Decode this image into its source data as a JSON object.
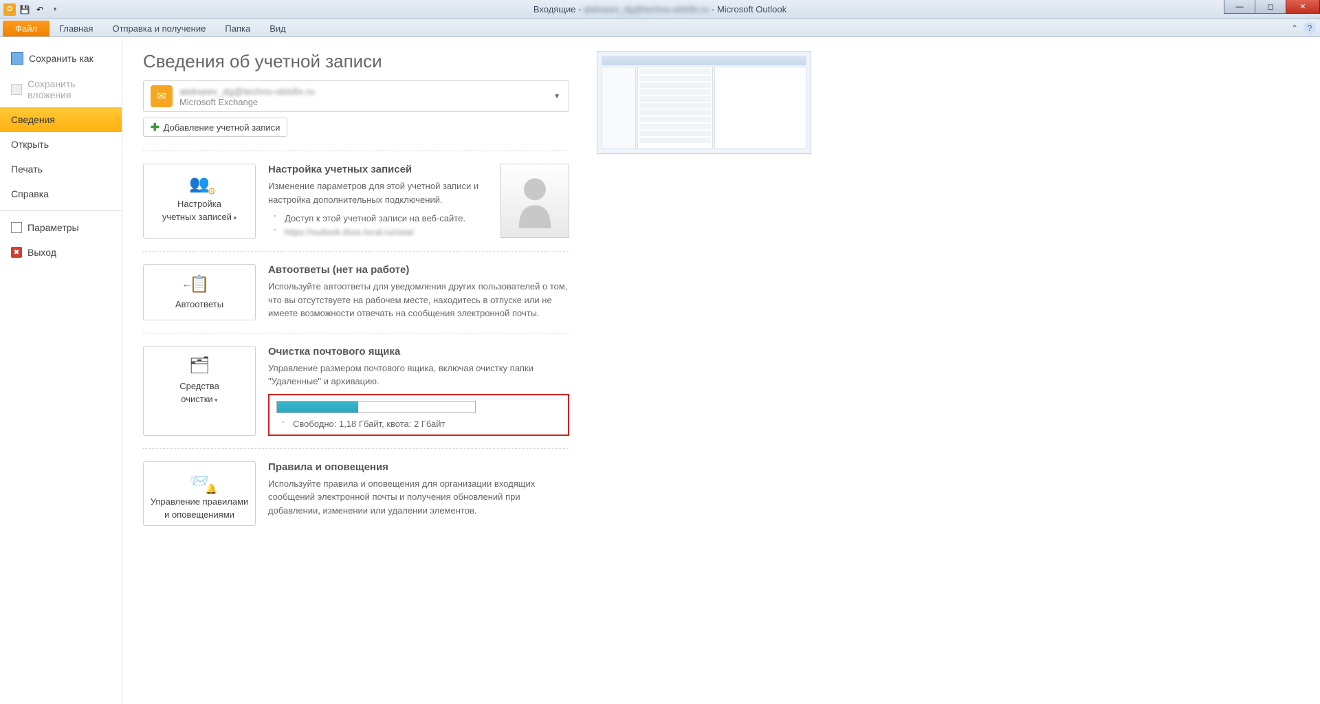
{
  "titlebar": {
    "inbox": "Входящие -",
    "email_blur": "alekseev_dg@techno-oblsfin.ru",
    "app": "- Microsoft Outlook"
  },
  "ribbon": {
    "file": "Файл",
    "home": "Главная",
    "sendreceive": "Отправка и получение",
    "folder": "Папка",
    "view": "Вид"
  },
  "nav": {
    "save_as": "Сохранить как",
    "save_attach": "Сохранить вложения",
    "info": "Сведения",
    "open": "Открыть",
    "print": "Печать",
    "help": "Справка",
    "options": "Параметры",
    "exit": "Выход"
  },
  "page": {
    "title": "Сведения об учетной записи",
    "account_blur": "alekseev_dg@techno-oblsfin.ru",
    "account_type": "Microsoft Exchange",
    "add_account": "Добавление учетной записи"
  },
  "sec_settings": {
    "btn_line1": "Настройка",
    "btn_line2": "учетных записей",
    "title": "Настройка учетных записей",
    "desc": "Изменение параметров для этой учетной записи и настройка дополнительных подключений.",
    "bullet1": "Доступ к этой учетной записи на веб-сайте.",
    "bullet2_blur": "https://outlook.dsss.local.ru/owa/"
  },
  "sec_auto": {
    "btn": "Автоответы",
    "title": "Автоответы (нет на работе)",
    "desc": "Используйте автоответы для уведомления других пользователей о том, что вы отсутствуете на рабочем месте, находитесь в отпуске или не имеете возможности отвечать на сообщения электронной почты."
  },
  "sec_clean": {
    "btn_line1": "Средства",
    "btn_line2": "очистки",
    "title": "Очистка почтового ящика",
    "desc": "Управление размером почтового ящика, включая очистку папки \"Удаленные\" и архивацию.",
    "quota_text": "Свободно: 1,18 Гбайт, квота: 2 Гбайт",
    "quota_fill_pct": 41
  },
  "sec_rules": {
    "btn_line1": "Управление правилами",
    "btn_line2": "и оповещениями",
    "title": "Правила и оповещения",
    "desc": "Используйте правила и оповещения для организации входящих сообщений электронной почты и получения обновлений при добавлении, изменении или удалении элементов."
  }
}
